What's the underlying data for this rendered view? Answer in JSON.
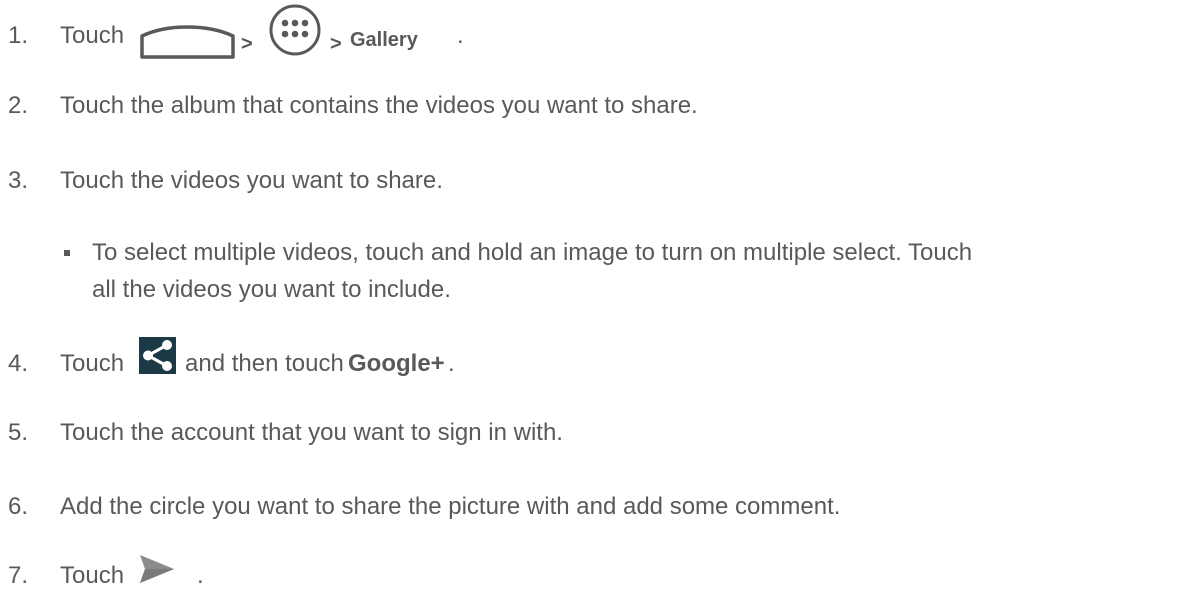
{
  "steps": [
    {
      "num": "1.",
      "prefix": "Touch",
      "sep1": ">",
      "sep2": ">",
      "bold": "Gallery",
      "suffix": "."
    },
    {
      "num": "2.",
      "text": "Touch the album that contains the videos you want to share."
    },
    {
      "num": "3.",
      "text": "Touch the videos you want to share."
    },
    {
      "num": "4.",
      "prefix": "Touch",
      "middle": "and then touch",
      "bold": "Google+",
      "suffix": "."
    },
    {
      "num": "5.",
      "text": "Touch the account that you want to sign in with."
    },
    {
      "num": "6.",
      "text": "Add the circle you want to share the picture with and add some comment."
    },
    {
      "num": "7.",
      "prefix": "Touch",
      "suffix": "."
    }
  ],
  "bullet": {
    "line1": "To select multiple videos, touch and hold an image to turn on multiple select. Touch",
    "line2": "all the videos you want to include."
  },
  "icons": {
    "home": "home-icon",
    "apps": "apps-icon",
    "share": "share-icon",
    "send": "send-icon"
  },
  "colors": {
    "text": "#595959",
    "share_icon_bg": "#1b3a45",
    "send_icon": "#8c8c8c"
  }
}
